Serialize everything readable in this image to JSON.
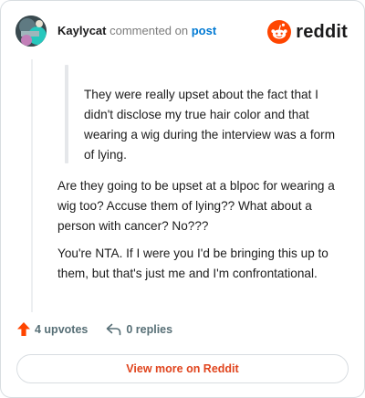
{
  "header": {
    "username": "Kaylycat",
    "action": "commented on",
    "link": "post"
  },
  "brand": {
    "wordmark": "reddit",
    "icon": "reddit-snoo-icon",
    "color": "#ff4500"
  },
  "comment": {
    "quote": "They were really upset about the fact that I didn't disclose my true hair color and that wearing a wig during the interview was a form of lying.",
    "paragraphs": [
      "Are they going to be upset at a blpoc for wearing a wig too? Accuse them of lying?? What about a person with cancer? No???",
      "You're NTA. If I were you I'd be bringing this up to them, but that's just me and I'm confrontational."
    ]
  },
  "stats": {
    "upvotes": "4 upvotes",
    "replies": "0 replies",
    "upvote_icon": "upvote-arrow-icon",
    "reply_icon": "reply-arrow-icon",
    "upvote_color": "#ff4500"
  },
  "footer": {
    "view_more": "View more on Reddit"
  }
}
